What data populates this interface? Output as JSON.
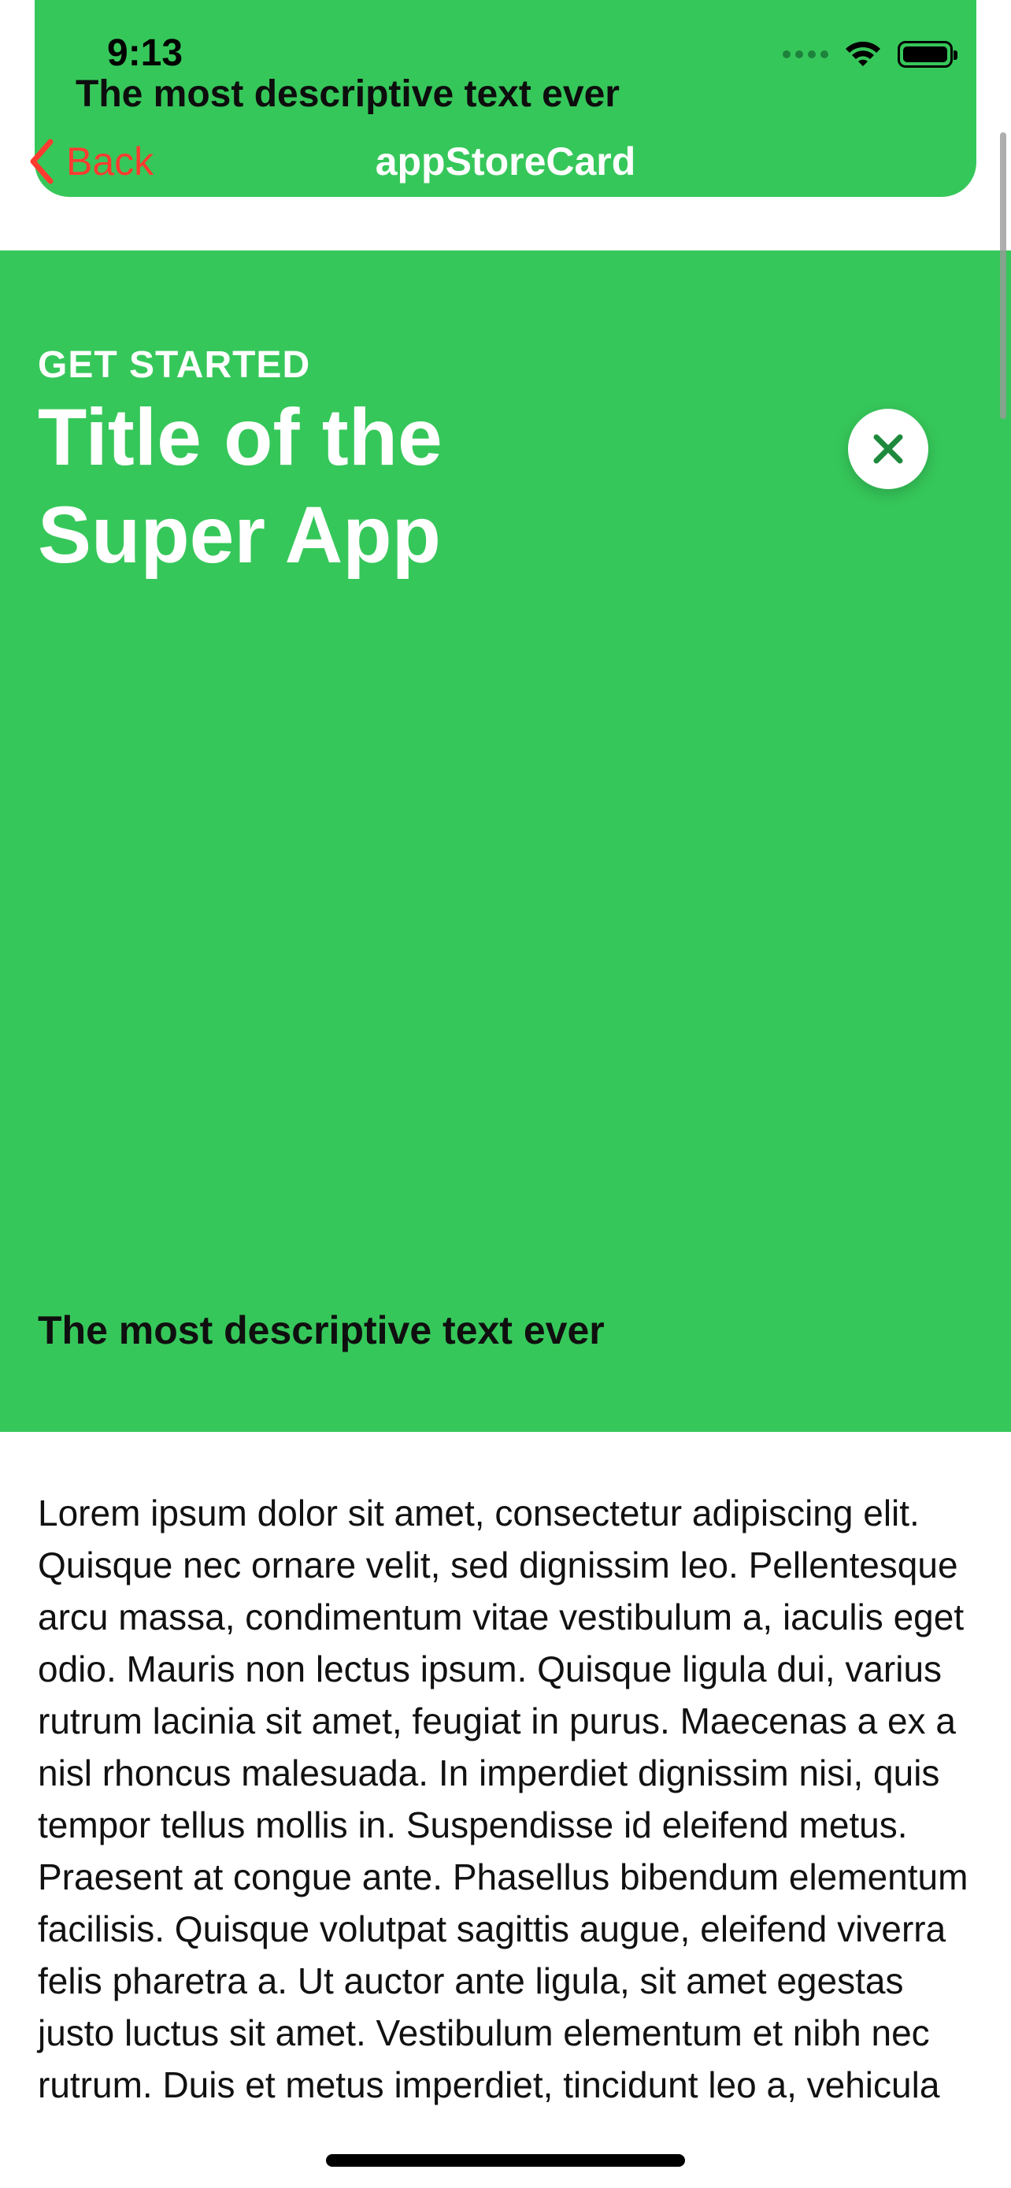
{
  "status_bar": {
    "time": "9:13",
    "icons": [
      "signal-icon",
      "wifi-icon",
      "battery-icon"
    ]
  },
  "header": {
    "subtitle": "The most descriptive text ever",
    "back_label": "Back",
    "title": "appStoreCard"
  },
  "card": {
    "eyebrow": "GET STARTED",
    "title": "Title of the Super App",
    "description": "The most descriptive text ever",
    "close_icon": "close-icon"
  },
  "body": {
    "text": "Lorem ipsum dolor sit amet, consectetur adipiscing elit. Quisque nec ornare velit, sed dignissim leo. Pellentesque arcu massa, condimentum vitae vestibulum a, iaculis eget odio. Mauris non lectus ipsum. Quisque ligula dui, varius rutrum lacinia sit amet, feugiat in purus. Maecenas a ex a nisl rhoncus malesuada. In imperdiet dignissim nisi, quis tempor tellus mollis in. Suspendisse id eleifend metus. Praesent at congue ante. Phasellus bibendum elementum facilisis. Quisque volutpat sagittis augue, eleifend viverra felis pharetra a. Ut auctor ante ligula, sit amet egestas justo luctus sit amet. Vestibulum elementum et nibh nec rutrum. Duis et metus imperdiet, tincidunt leo a, vehicula"
  },
  "colors": {
    "accent_green": "#36c75a",
    "back_red": "#ff3b30",
    "close_icon_green": "#1f8a3d"
  }
}
